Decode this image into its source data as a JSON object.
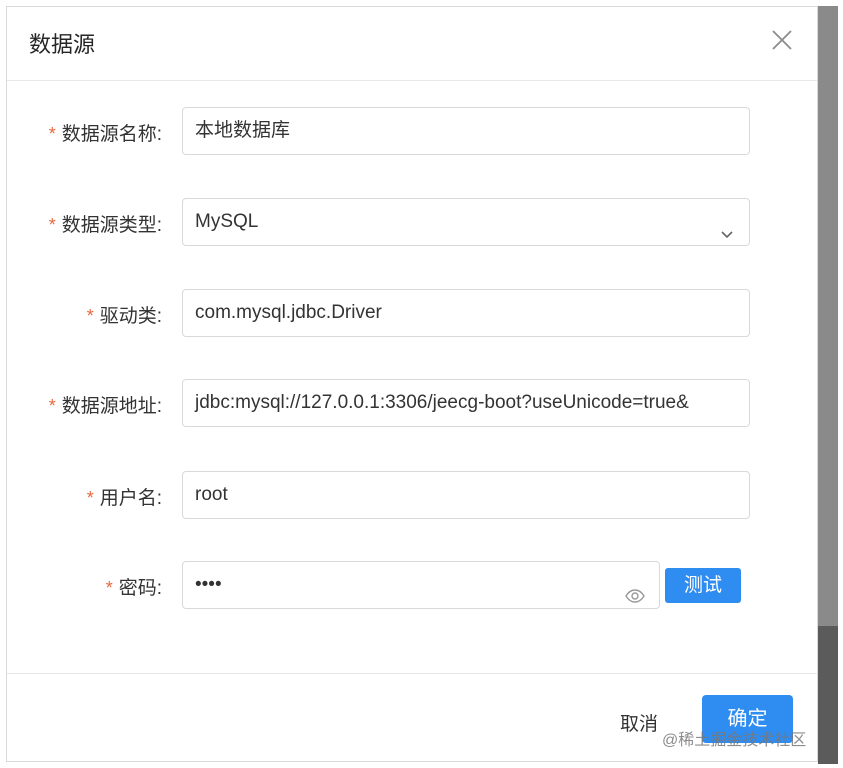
{
  "dialog": {
    "title": "数据源"
  },
  "form": {
    "required_mark": "*",
    "fields": [
      {
        "label": "数据源名称:",
        "value": "本地数据库"
      },
      {
        "label": "数据源类型:",
        "value": "MySQL"
      },
      {
        "label": "驱动类:",
        "value": "com.mysql.jdbc.Driver"
      },
      {
        "label": "数据源地址:",
        "value": "jdbc:mysql://127.0.0.1:3306/jeecg-boot?useUnicode=true&"
      },
      {
        "label": "用户名:",
        "value": "root"
      },
      {
        "label": "密码:",
        "value": "••••"
      }
    ],
    "test_button": "测试"
  },
  "footer": {
    "cancel_label": "取消",
    "ok_label": "确定"
  },
  "watermark": "@稀土掘金技术社区",
  "colors": {
    "primary": "#2f8cf0",
    "required": "#e8683d"
  }
}
